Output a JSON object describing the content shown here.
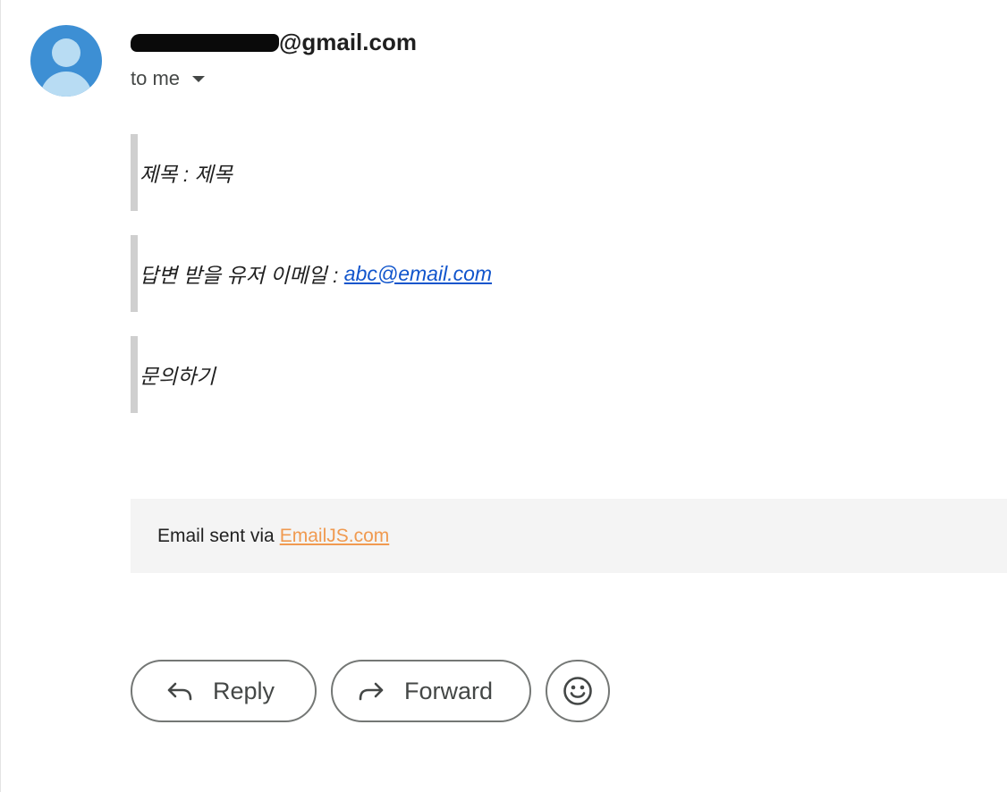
{
  "message": {
    "sender_visible": "@gmail.com",
    "recipient_label": "to me"
  },
  "body": {
    "subject_line": "제목 : 제목",
    "reply_email_label": "답변 받을 유저 이메일 : ",
    "reply_email_link": "abc@email.com",
    "inquiry_text": "문의하기"
  },
  "footer": {
    "prefix": "Email sent via",
    "link": "EmailJS.com"
  },
  "actions": {
    "reply": "Reply",
    "forward": "Forward"
  },
  "colors": {
    "avatar_bg": "#3d8fd4",
    "link": "#1155cc",
    "footer_link": "#f09a50"
  },
  "icons": {
    "avatar": "person-icon",
    "caret": "caret-down-icon",
    "reply": "reply-arrow-icon",
    "forward": "forward-arrow-icon",
    "emoji": "smiley-icon"
  }
}
